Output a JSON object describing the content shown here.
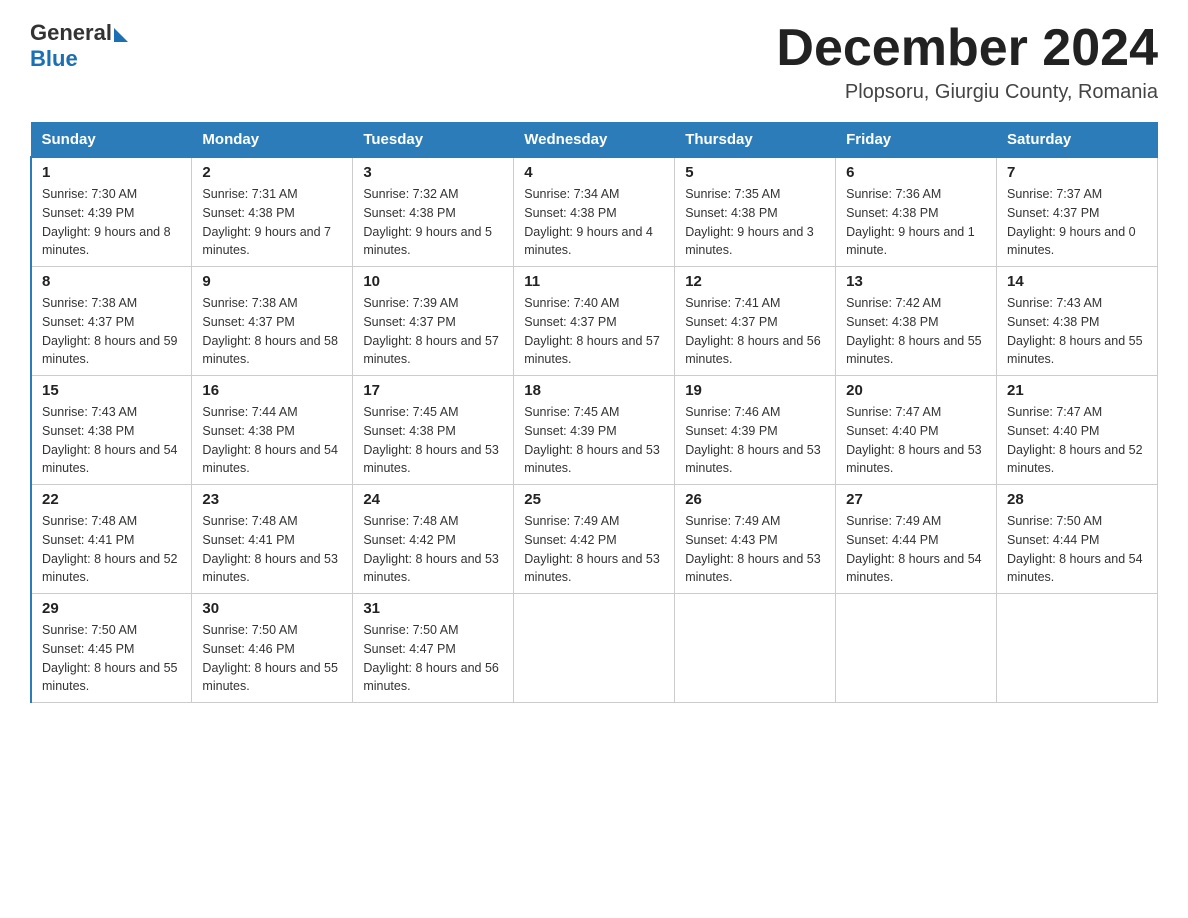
{
  "header": {
    "logo": {
      "general": "General",
      "blue": "Blue"
    },
    "title": "December 2024",
    "location": "Plopsoru, Giurgiu County, Romania"
  },
  "days_of_week": [
    "Sunday",
    "Monday",
    "Tuesday",
    "Wednesday",
    "Thursday",
    "Friday",
    "Saturday"
  ],
  "weeks": [
    [
      {
        "day": "1",
        "sunrise": "7:30 AM",
        "sunset": "4:39 PM",
        "daylight": "9 hours and 8 minutes."
      },
      {
        "day": "2",
        "sunrise": "7:31 AM",
        "sunset": "4:38 PM",
        "daylight": "9 hours and 7 minutes."
      },
      {
        "day": "3",
        "sunrise": "7:32 AM",
        "sunset": "4:38 PM",
        "daylight": "9 hours and 5 minutes."
      },
      {
        "day": "4",
        "sunrise": "7:34 AM",
        "sunset": "4:38 PM",
        "daylight": "9 hours and 4 minutes."
      },
      {
        "day": "5",
        "sunrise": "7:35 AM",
        "sunset": "4:38 PM",
        "daylight": "9 hours and 3 minutes."
      },
      {
        "day": "6",
        "sunrise": "7:36 AM",
        "sunset": "4:38 PM",
        "daylight": "9 hours and 1 minute."
      },
      {
        "day": "7",
        "sunrise": "7:37 AM",
        "sunset": "4:37 PM",
        "daylight": "9 hours and 0 minutes."
      }
    ],
    [
      {
        "day": "8",
        "sunrise": "7:38 AM",
        "sunset": "4:37 PM",
        "daylight": "8 hours and 59 minutes."
      },
      {
        "day": "9",
        "sunrise": "7:38 AM",
        "sunset": "4:37 PM",
        "daylight": "8 hours and 58 minutes."
      },
      {
        "day": "10",
        "sunrise": "7:39 AM",
        "sunset": "4:37 PM",
        "daylight": "8 hours and 57 minutes."
      },
      {
        "day": "11",
        "sunrise": "7:40 AM",
        "sunset": "4:37 PM",
        "daylight": "8 hours and 57 minutes."
      },
      {
        "day": "12",
        "sunrise": "7:41 AM",
        "sunset": "4:37 PM",
        "daylight": "8 hours and 56 minutes."
      },
      {
        "day": "13",
        "sunrise": "7:42 AM",
        "sunset": "4:38 PM",
        "daylight": "8 hours and 55 minutes."
      },
      {
        "day": "14",
        "sunrise": "7:43 AM",
        "sunset": "4:38 PM",
        "daylight": "8 hours and 55 minutes."
      }
    ],
    [
      {
        "day": "15",
        "sunrise": "7:43 AM",
        "sunset": "4:38 PM",
        "daylight": "8 hours and 54 minutes."
      },
      {
        "day": "16",
        "sunrise": "7:44 AM",
        "sunset": "4:38 PM",
        "daylight": "8 hours and 54 minutes."
      },
      {
        "day": "17",
        "sunrise": "7:45 AM",
        "sunset": "4:38 PM",
        "daylight": "8 hours and 53 minutes."
      },
      {
        "day": "18",
        "sunrise": "7:45 AM",
        "sunset": "4:39 PM",
        "daylight": "8 hours and 53 minutes."
      },
      {
        "day": "19",
        "sunrise": "7:46 AM",
        "sunset": "4:39 PM",
        "daylight": "8 hours and 53 minutes."
      },
      {
        "day": "20",
        "sunrise": "7:47 AM",
        "sunset": "4:40 PM",
        "daylight": "8 hours and 53 minutes."
      },
      {
        "day": "21",
        "sunrise": "7:47 AM",
        "sunset": "4:40 PM",
        "daylight": "8 hours and 52 minutes."
      }
    ],
    [
      {
        "day": "22",
        "sunrise": "7:48 AM",
        "sunset": "4:41 PM",
        "daylight": "8 hours and 52 minutes."
      },
      {
        "day": "23",
        "sunrise": "7:48 AM",
        "sunset": "4:41 PM",
        "daylight": "8 hours and 53 minutes."
      },
      {
        "day": "24",
        "sunrise": "7:48 AM",
        "sunset": "4:42 PM",
        "daylight": "8 hours and 53 minutes."
      },
      {
        "day": "25",
        "sunrise": "7:49 AM",
        "sunset": "4:42 PM",
        "daylight": "8 hours and 53 minutes."
      },
      {
        "day": "26",
        "sunrise": "7:49 AM",
        "sunset": "4:43 PM",
        "daylight": "8 hours and 53 minutes."
      },
      {
        "day": "27",
        "sunrise": "7:49 AM",
        "sunset": "4:44 PM",
        "daylight": "8 hours and 54 minutes."
      },
      {
        "day": "28",
        "sunrise": "7:50 AM",
        "sunset": "4:44 PM",
        "daylight": "8 hours and 54 minutes."
      }
    ],
    [
      {
        "day": "29",
        "sunrise": "7:50 AM",
        "sunset": "4:45 PM",
        "daylight": "8 hours and 55 minutes."
      },
      {
        "day": "30",
        "sunrise": "7:50 AM",
        "sunset": "4:46 PM",
        "daylight": "8 hours and 55 minutes."
      },
      {
        "day": "31",
        "sunrise": "7:50 AM",
        "sunset": "4:47 PM",
        "daylight": "8 hours and 56 minutes."
      },
      null,
      null,
      null,
      null
    ]
  ],
  "labels": {
    "sunrise": "Sunrise:",
    "sunset": "Sunset:",
    "daylight": "Daylight:"
  }
}
